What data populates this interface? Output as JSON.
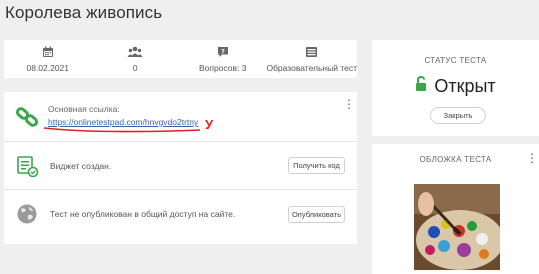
{
  "page": {
    "title": "Королева живопись"
  },
  "stats": [
    {
      "icon": "calendar-icon",
      "value": "08.02.2021"
    },
    {
      "icon": "users-icon",
      "value": "0"
    },
    {
      "icon": "question-icon",
      "value": "Вопросов: 3"
    },
    {
      "icon": "test-type-icon",
      "value": "Образовательный тест"
    }
  ],
  "link_row": {
    "label": "Основная ссылка:",
    "url": "https://onlinetestpad.com/hnvgvdo2trtny",
    "annotation": "У"
  },
  "widget_row": {
    "text": "Виджет создан.",
    "button": "Получить код"
  },
  "publish_row": {
    "text": "Тест не опубликован в общий доступ на сайте.",
    "button": "Опубликовать"
  },
  "status": {
    "heading": "СТАТУС ТЕСТА",
    "value": "Открыт",
    "button": "Закрыть"
  },
  "cover": {
    "heading": "ОБЛОЖКА ТЕСТА"
  },
  "colors": {
    "green": "#3aa64a",
    "link": "#3a5fb0",
    "annotation": "#e02020"
  }
}
